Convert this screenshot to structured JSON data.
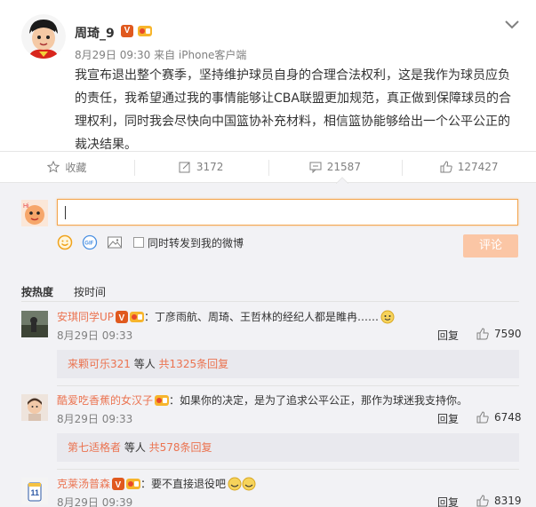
{
  "post": {
    "username": "周琦_9",
    "verified_badge": "V",
    "club_badge_icon": "vip-club-icon",
    "meta": "8月29日 09:30 来自 iPhone客户端",
    "text": "我宣布退出整个赛季，坚持维护球员自身的合理合法权利，这是我作为球员应负的责任，我希望通过我的事情能够让CBA联盟更加规范，真正做到保障球员的合理权利，同时我会尽快向中国篮协补充材料，相信篮协能够给出一个公平公正的裁决结果。"
  },
  "actions": {
    "favorite": "收藏",
    "repost_count": "3172",
    "comment_count": "21587",
    "like_count": "127427"
  },
  "composer": {
    "input_value": "",
    "repost_checkbox_label": "同时转发到我的微博",
    "submit_label": "评论"
  },
  "sort": {
    "hot": "按热度",
    "time": "按时间"
  },
  "comments": [
    {
      "name": "安琪同学UP",
      "text": "：丁彦雨航、周琦、王哲林的经纪人都是睢冉……",
      "time": "8月29日 09:33",
      "reply": "回复",
      "likes": "7590",
      "sub": {
        "name": "来颗可乐321",
        "mid": " 等人 ",
        "count": "共1325条回复"
      }
    },
    {
      "name": "酷爱吃香蕉的女汉子",
      "text": "：如果你的决定，是为了追求公平公正，那作为球迷我支持你。",
      "time": "8月29日 09:33",
      "reply": "回复",
      "likes": "6748",
      "sub": {
        "name": "第七适格者",
        "mid": " 等人 ",
        "count": "共578条回复"
      }
    },
    {
      "name": "克莱汤普森",
      "text": "：要不直接退役吧",
      "time": "8月29日 09:39",
      "reply": "回复",
      "likes": "8319"
    }
  ]
}
